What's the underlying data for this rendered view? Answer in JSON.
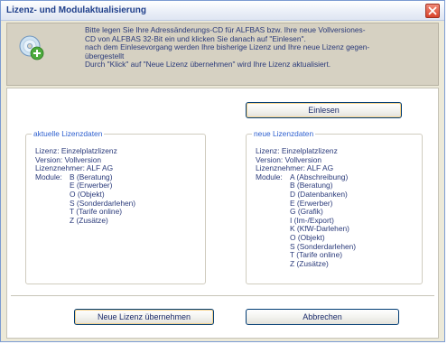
{
  "window": {
    "title": "Lizenz- und Modulaktualisierung",
    "close_icon": "close-x"
  },
  "info": {
    "icon": "cd-add-icon",
    "lines": [
      "Bitte legen Sie Ihre Adressänderungs-CD für ALFBAS bzw. Ihre neue Vollversiones-",
      "CD von ALFBAS 32-Bit ein und klicken Sie danach auf \"Einlesen\".",
      "nach dem Einlesevorgang werden Ihre bisherige Lizenz und Ihre neue Lizenz gegen-",
      "übergestellt",
      "Durch \"Klick\" auf \"Neue Lizenz übernehmen\" wird Ihre Lizenz aktualisiert."
    ]
  },
  "buttons": {
    "einlesen": "Einlesen",
    "neue_lizenz": "Neue Lizenz übernehmen",
    "abbrechen": "Abbrechen"
  },
  "current": {
    "legend": "aktuelle Lizenzdaten",
    "lizenz": "Lizenz: Einzelplatzlizenz",
    "version": "Version: Vollversion",
    "nehmer": "Lizenznehmer: ALF AG",
    "module_label": "Module:",
    "modules": [
      "B (Beratung)",
      "E (Erwerber)",
      "O (Objekt)",
      "S (Sonderdarlehen)",
      "T (Tarife online)",
      "Z (Zusätze)"
    ]
  },
  "new": {
    "legend": "neue Lizenzdaten",
    "lizenz": "Lizenz: Einzelplatzlizenz",
    "version": "Version: Vollversion",
    "nehmer": "Lizenznehmer: ALF AG",
    "module_label": "Module:",
    "modules": [
      "A (Abschreibung)",
      "B (Beratung)",
      "D (Datenbanken)",
      "E (Erwerber)",
      "G (Grafik)",
      "I (Im-/Export)",
      "K (KfW-Darlehen)",
      "O (Objekt)",
      "S (Sonderdarlehen)",
      "T (Tarife online)",
      "Z (Zusätze)"
    ]
  }
}
